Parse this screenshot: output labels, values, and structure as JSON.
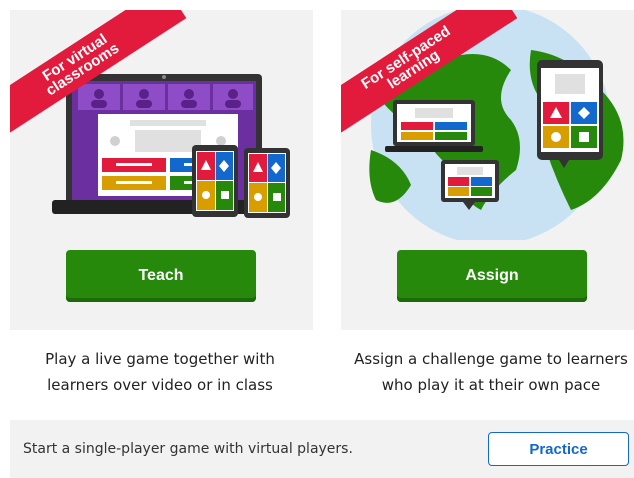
{
  "teach_card": {
    "ribbon_line1": "For virtual",
    "ribbon_line2": "classrooms",
    "button_label": "Teach",
    "description_line1": "Play a live game together with",
    "description_line2": "learners over video or in class"
  },
  "assign_card": {
    "ribbon_line1": "For self-paced",
    "ribbon_line2": "learning",
    "button_label": "Assign",
    "description_line1": "Assign a challenge game to learners",
    "description_line2": "who play it at their own pace"
  },
  "practice": {
    "text": "Start a single-player game with virtual players.",
    "button_label": "Practice"
  },
  "colors": {
    "ribbon": "#e21b3c",
    "primary_button": "#26890c",
    "practice_accent": "#1368ce",
    "card_bg": "#f2f2f2",
    "answer_red": "#e21b3c",
    "answer_blue": "#1368ce",
    "answer_yellow": "#d89e00",
    "answer_green": "#26890c",
    "video_purple": "#6c2fa0"
  }
}
